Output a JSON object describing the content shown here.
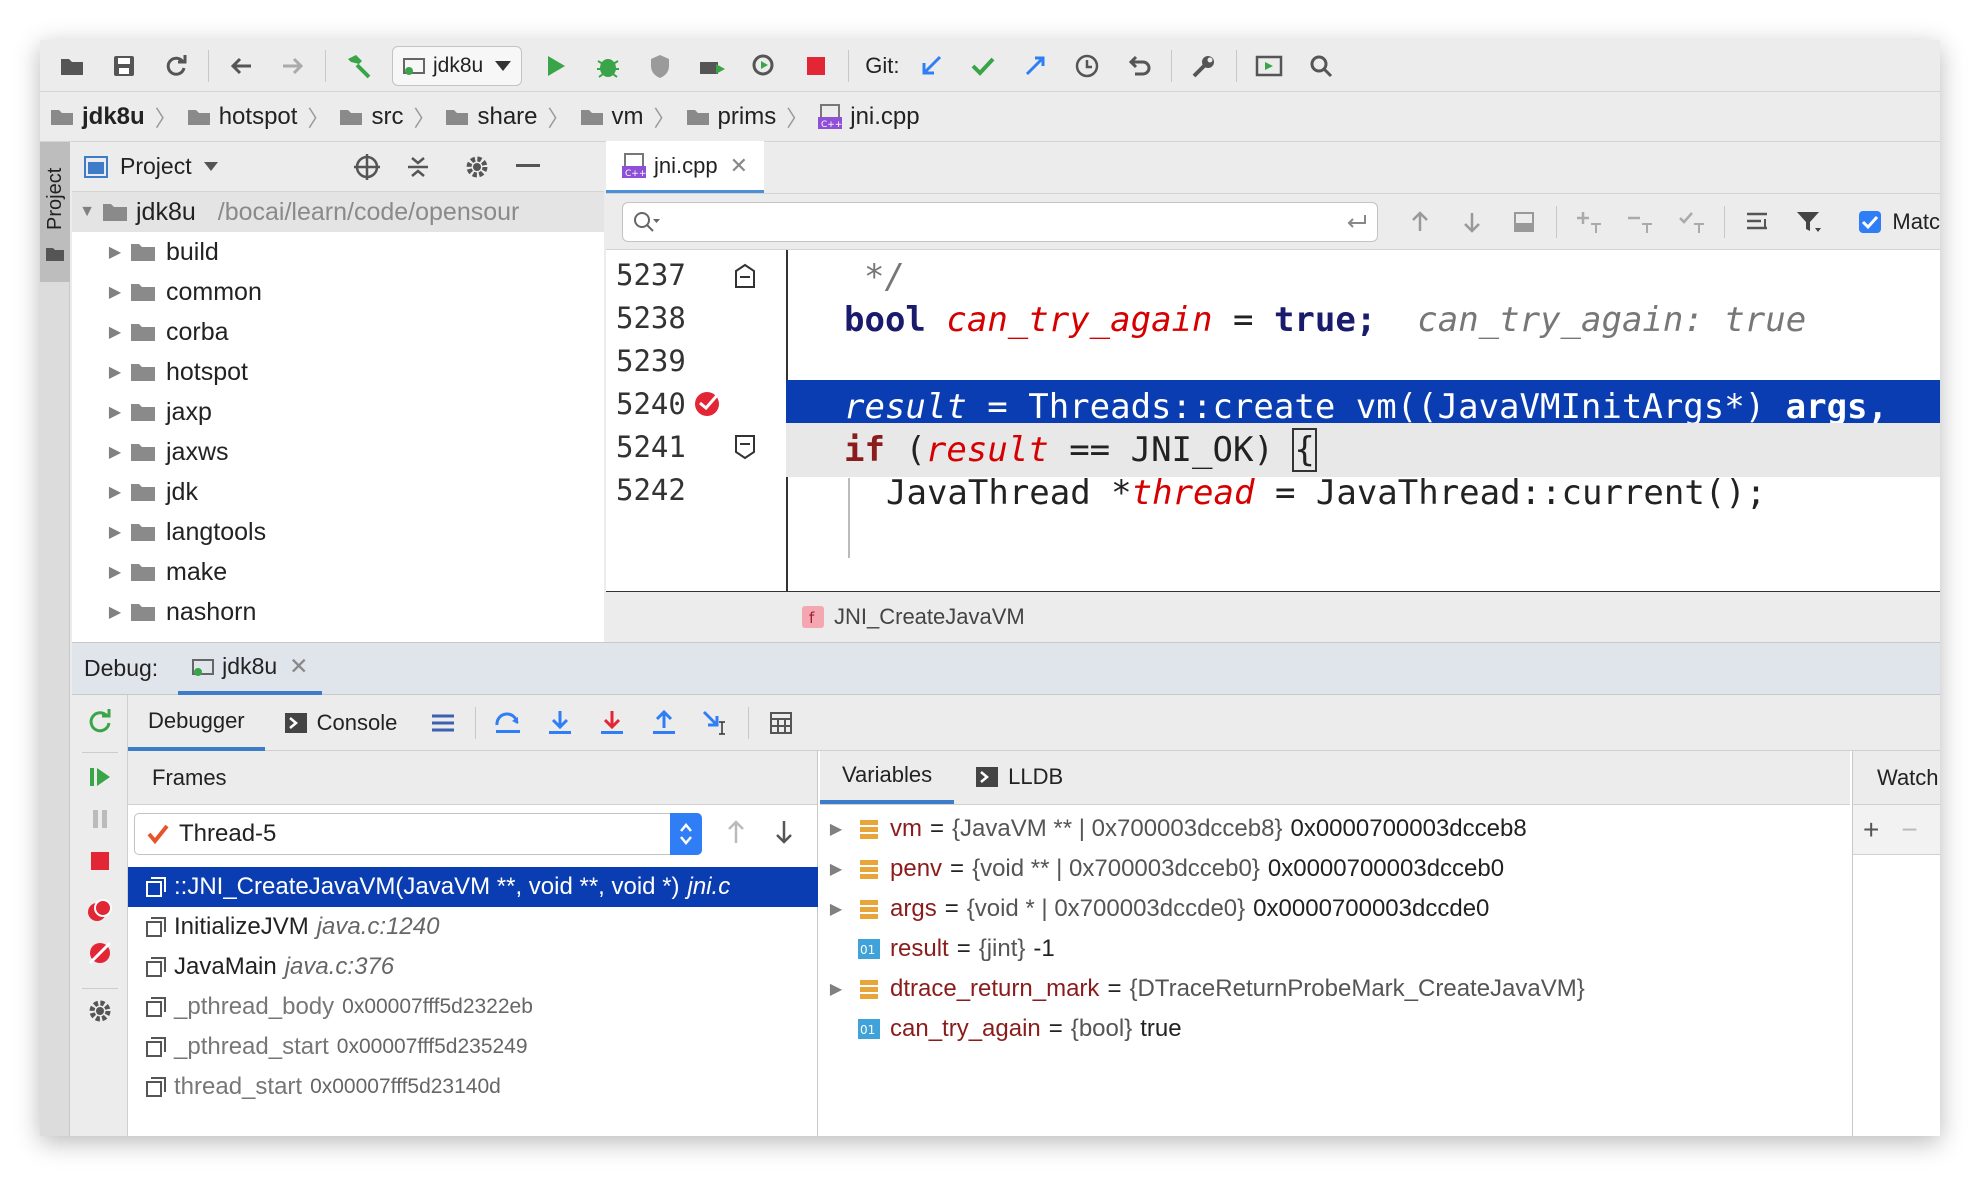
{
  "toolbar": {
    "run_config": "jdk8u",
    "git_label": "Git:"
  },
  "breadcrumb": [
    "jdk8u",
    "hotspot",
    "src",
    "share",
    "vm",
    "prims",
    "jni.cpp"
  ],
  "project": {
    "title": "Project",
    "stripe_label": "Project",
    "root_name": "jdk8u",
    "root_path": "/bocai/learn/code/opensour",
    "items": [
      "build",
      "common",
      "corba",
      "hotspot",
      "jaxp",
      "jaxws",
      "jdk",
      "langtools",
      "make",
      "nashorn"
    ]
  },
  "editor": {
    "tab_label": "jni.cpp",
    "find_checkbox_label": "Matc",
    "function_breadcrumb": "JNI_CreateJavaVM",
    "line_numbers": [
      "5237",
      "5238",
      "5239",
      "5240",
      "5241",
      "5242"
    ],
    "line1_comment": "*/",
    "line2": {
      "type": "bool",
      "var": "can_try_again",
      "op": "=",
      "value": "true;",
      "hint": "can_try_again: true"
    },
    "line4": {
      "var": "result",
      "rest": " = Threads::create_vm((JavaVMInitArgs*) ",
      "args": "args,"
    },
    "line5": {
      "kw": "if",
      "open": " (",
      "var": "result",
      "rest": " == JNI_OK) ",
      "brace": "{"
    },
    "line6": {
      "pre": "JavaThread *",
      "var": "thread",
      "rest": " = JavaThread::current();"
    }
  },
  "debug": {
    "label": "Debug:",
    "session_tab": "jdk8u",
    "tabs": [
      "Debugger",
      "Console"
    ],
    "frames_header": "Frames",
    "thread": "Thread-5",
    "frames": [
      {
        "name": "::JNI_CreateJavaVM(JavaVM **, void **, void *)",
        "loc": "jni.c"
      },
      {
        "name": "InitializeJVM",
        "loc": "java.c:1240"
      },
      {
        "name": "JavaMain",
        "loc": "java.c:376"
      },
      {
        "name": "_pthread_body",
        "addr": "0x00007fff5d2322eb"
      },
      {
        "name": "_pthread_start",
        "addr": "0x00007fff5d235249"
      },
      {
        "name": "thread_start",
        "addr": "0x00007fff5d23140d"
      }
    ],
    "var_tabs": [
      "Variables",
      "LLDB"
    ],
    "watch_header": "Watch",
    "variables": [
      {
        "name": "vm",
        "type": "{JavaVM ** | 0x700003dcceb8}",
        "value": "0x0000700003dcceb8"
      },
      {
        "name": "penv",
        "type": "{void ** | 0x700003dcceb0}",
        "value": "0x0000700003dcceb0"
      },
      {
        "name": "args",
        "type": "{void * | 0x700003dccde0}",
        "value": "0x0000700003dccde0"
      },
      {
        "name": "result",
        "type": "{jint}",
        "value": "-1"
      },
      {
        "name": "dtrace_return_mark",
        "type": "{DTraceReturnProbeMark_CreateJavaVM}",
        "value": ""
      },
      {
        "name": "can_try_again",
        "type": "{bool}",
        "value": "true"
      }
    ]
  },
  "colors": {
    "selection": "#0b3db2",
    "accent_blue": "#2f7ef6",
    "run_green": "#3aa548",
    "stop_red": "#e32636",
    "var_name": "#8b1c1c"
  }
}
